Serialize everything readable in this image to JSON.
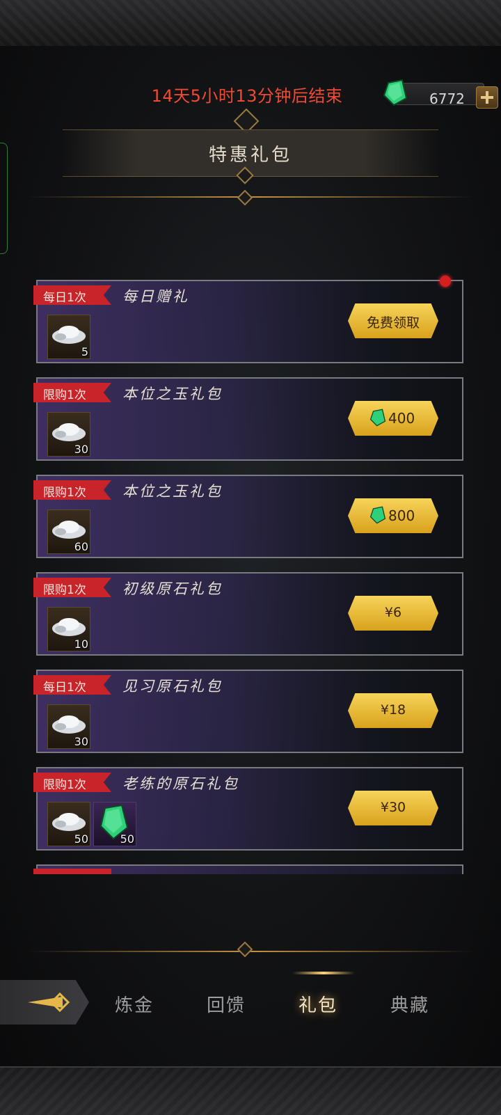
{
  "header": {
    "countdown": "14天5小时13分钟后结束",
    "currency_value": "6772",
    "title": "特惠礼包"
  },
  "packs": [
    {
      "tag": "每日1次",
      "name": "每日赠礼",
      "items": [
        {
          "icon": "silver-ingot-icon",
          "qty": "5"
        }
      ],
      "price_text": "免费领取",
      "price_type": "free",
      "notification": true
    },
    {
      "tag": "限购1次",
      "name": "本位之玉礼包",
      "items": [
        {
          "icon": "silver-ingot-icon",
          "qty": "30"
        }
      ],
      "price_text": "400",
      "price_type": "gem"
    },
    {
      "tag": "限购1次",
      "name": "本位之玉礼包",
      "items": [
        {
          "icon": "silver-ingot-icon",
          "qty": "60"
        }
      ],
      "price_text": "800",
      "price_type": "gem"
    },
    {
      "tag": "限购1次",
      "name": "初级原石礼包",
      "items": [
        {
          "icon": "silver-ingot-icon",
          "qty": "10"
        }
      ],
      "price_text": "¥6",
      "price_type": "cash"
    },
    {
      "tag": "每日1次",
      "name": "见习原石礼包",
      "items": [
        {
          "icon": "silver-ingot-icon",
          "qty": "30"
        }
      ],
      "price_text": "¥18",
      "price_type": "cash"
    },
    {
      "tag": "限购1次",
      "name": "老练的原石礼包",
      "items": [
        {
          "icon": "silver-ingot-icon",
          "qty": "50"
        },
        {
          "icon": "green-gem-icon",
          "qty": "50"
        }
      ],
      "price_text": "¥30",
      "price_type": "cash"
    }
  ],
  "nav": {
    "items": [
      "炼金",
      "回馈",
      "礼包",
      "典藏"
    ],
    "active": "礼包"
  },
  "colors": {
    "countdown": "#f04a32",
    "tag_red": "#c8242a",
    "button_gold": "#f6d45a",
    "gem_green": "#2fd07a"
  }
}
